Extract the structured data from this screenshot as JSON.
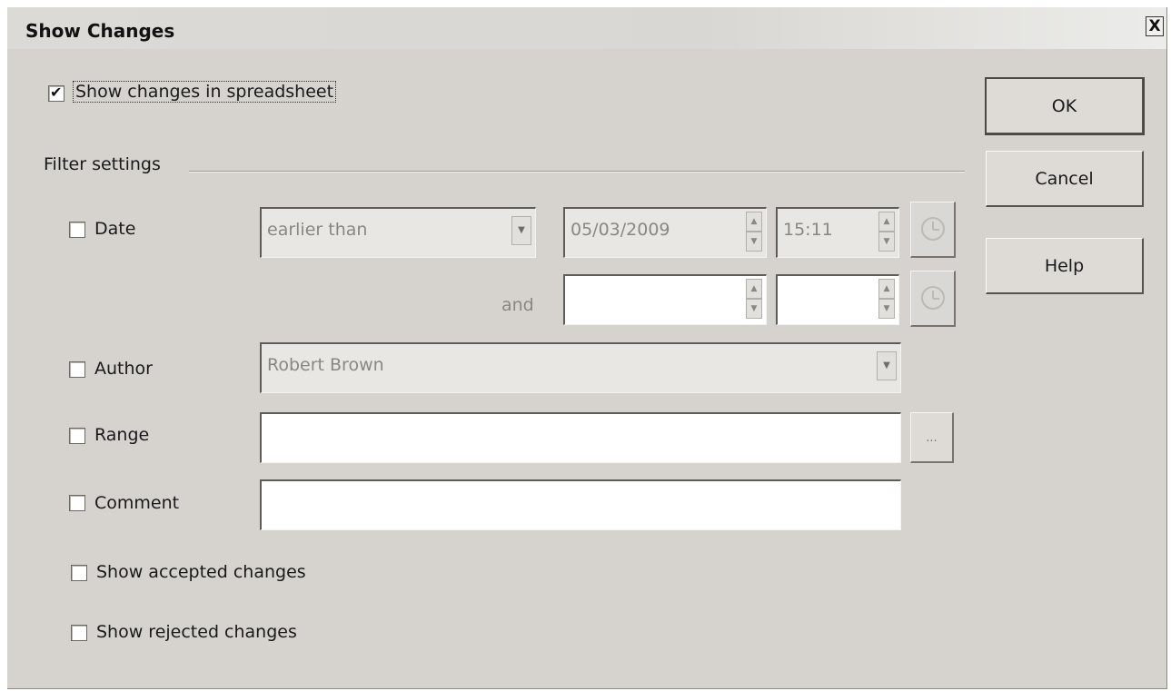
{
  "dialog": {
    "title": "Show Changes",
    "close_label": "X"
  },
  "show_changes": {
    "label": "Show changes in spreadsheet",
    "checked": true
  },
  "buttons": {
    "ok": "OK",
    "cancel": "Cancel",
    "help": "Help"
  },
  "filter": {
    "heading": "Filter settings",
    "date": {
      "label": "Date",
      "checked": false,
      "condition": "earlier than",
      "date_value": "05/03/2009",
      "time_value": "15:11",
      "and_label": "and",
      "date2_value": "",
      "time2_value": ""
    },
    "author": {
      "label": "Author",
      "checked": false,
      "value": "Robert Brown"
    },
    "range": {
      "label": "Range",
      "checked": false,
      "value": "",
      "browse_label": "..."
    },
    "comment": {
      "label": "Comment",
      "checked": false,
      "value": ""
    },
    "show_accepted": {
      "label": "Show accepted changes",
      "checked": false
    },
    "show_rejected": {
      "label": "Show rejected changes",
      "checked": false
    }
  },
  "icons": {
    "clock": "clock-icon",
    "spin_up": "spin-up-icon",
    "spin_down": "spin-down-icon",
    "dropdown": "chevron-down-icon",
    "checkmark": "checkmark-icon"
  }
}
